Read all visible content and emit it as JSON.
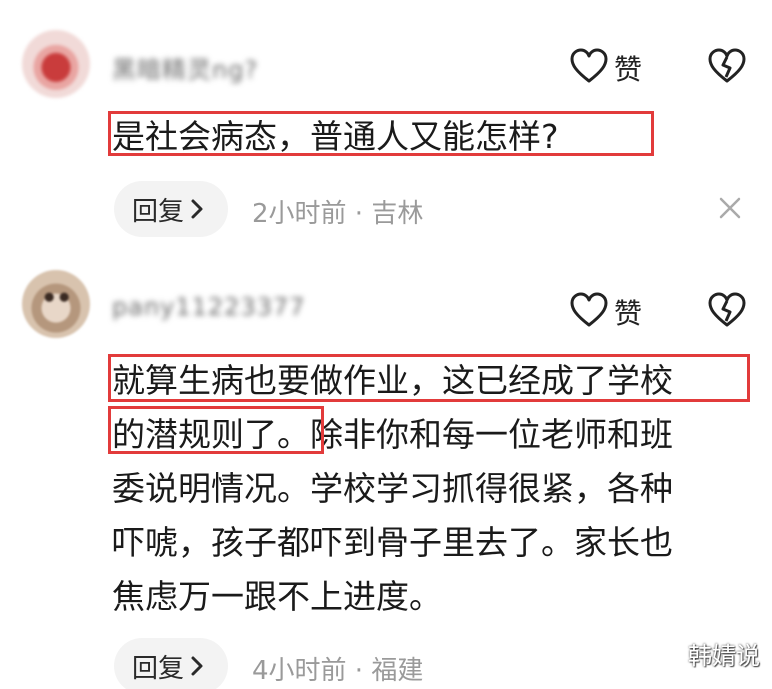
{
  "comments": [
    {
      "username": "黑暗精灵ng?",
      "like_label": "赞",
      "text": "是社会病态，普通人又能怎样?",
      "reply_label": "回复",
      "meta": "2小时前 · 吉林"
    },
    {
      "username": "pany11223377",
      "like_label": "赞",
      "text_line1": "就算生病也要做作业，这已经成了学校",
      "text_line2_hl": "的潜规则了。",
      "text_line2_rest": "除非你和每一位老师和班",
      "text_rest": "委说明情况。学校学习抓得很紧，各种\n吓唬，孩子都吓到骨子里去了。家长也\n焦虑万一跟不上进度。",
      "reply_label": "回复",
      "meta": "4小时前 · 福建"
    }
  ],
  "watermark": "韩婧说",
  "icons": {
    "like": "heart-outline-icon",
    "dislike": "broken-heart-icon",
    "reply_arrow": "chevron-right-icon",
    "close": "close-icon"
  },
  "colors": {
    "highlight": "#e23b3b"
  }
}
